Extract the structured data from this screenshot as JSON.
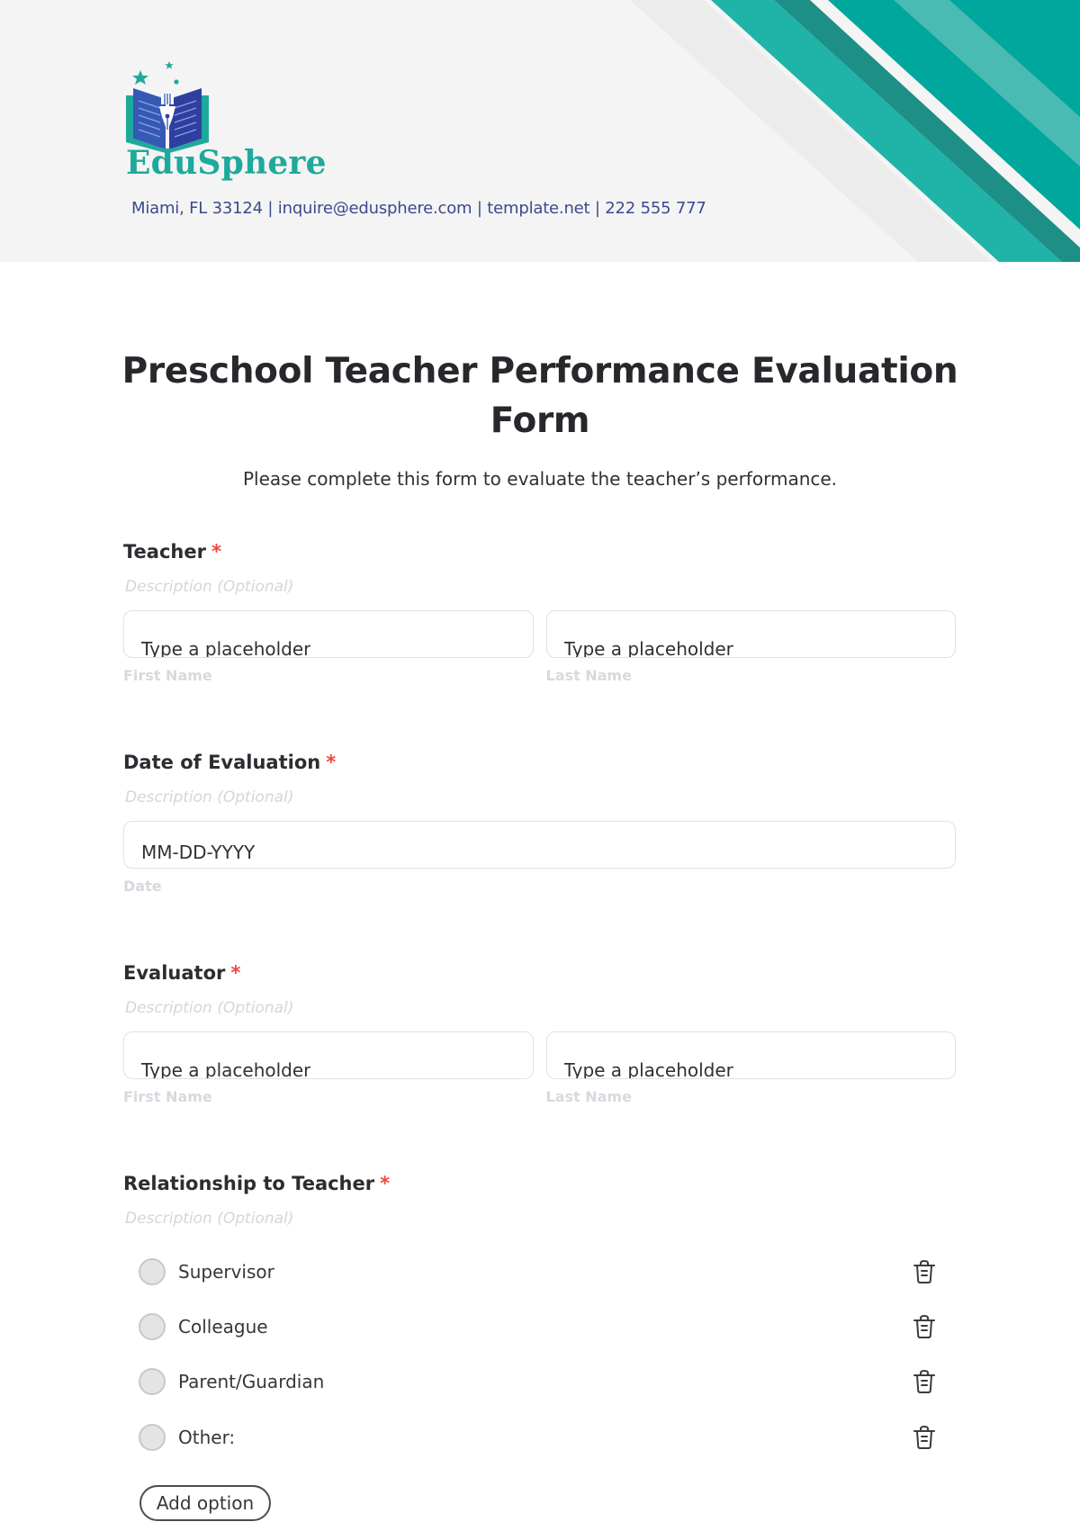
{
  "header": {
    "brand_name": "EduSphere",
    "contact_line": "Miami, FL 33124 | inquire@edusphere.com | template.net | 222 555 777",
    "logo_icon": "open-book-pen-stars-icon",
    "colors": {
      "background": "#f4f4f4",
      "teal_primary": "#00a79d",
      "teal_light": "#20b3a8",
      "teal_dark": "#1e8f86",
      "teal_pale": "#4abbb2",
      "gray_band": "#ececec",
      "brand_text": "#1fa99b",
      "contact_text": "#3a4a8c"
    }
  },
  "form": {
    "title": "Preschool Teacher Performance Evaluation Form",
    "subtitle": "Please complete this form to evaluate the teacher’s performance.",
    "required_marker": "*",
    "required_color": "#f0473a",
    "questions": [
      {
        "label": "Teacher",
        "description_placeholder": "Description (Optional)",
        "fields": [
          {
            "placeholder": "Type a placeholder",
            "sub_label": "First Name"
          },
          {
            "placeholder": "Type a placeholder",
            "sub_label": "Last Name"
          }
        ]
      },
      {
        "label": "Date of Evaluation",
        "description_placeholder": "Description (Optional)",
        "fields": [
          {
            "placeholder": "MM-DD-YYYY",
            "sub_label": "Date"
          }
        ]
      },
      {
        "label": "Evaluator",
        "description_placeholder": "Description (Optional)",
        "fields": [
          {
            "placeholder": "Type a placeholder",
            "sub_label": "First Name"
          },
          {
            "placeholder": "Type a placeholder",
            "sub_label": "Last Name"
          }
        ]
      },
      {
        "label": "Relationship to Teacher",
        "description_placeholder": "Description (Optional)",
        "options": [
          {
            "label": "Supervisor",
            "action_icon": "trash-icon"
          },
          {
            "label": "Colleague",
            "action_icon": "trash-icon"
          },
          {
            "label": "Parent/Guardian",
            "action_icon": "trash-icon"
          },
          {
            "label": "Other:",
            "action_icon": "trash-icon"
          }
        ],
        "add_option_label": "Add option"
      }
    ]
  }
}
